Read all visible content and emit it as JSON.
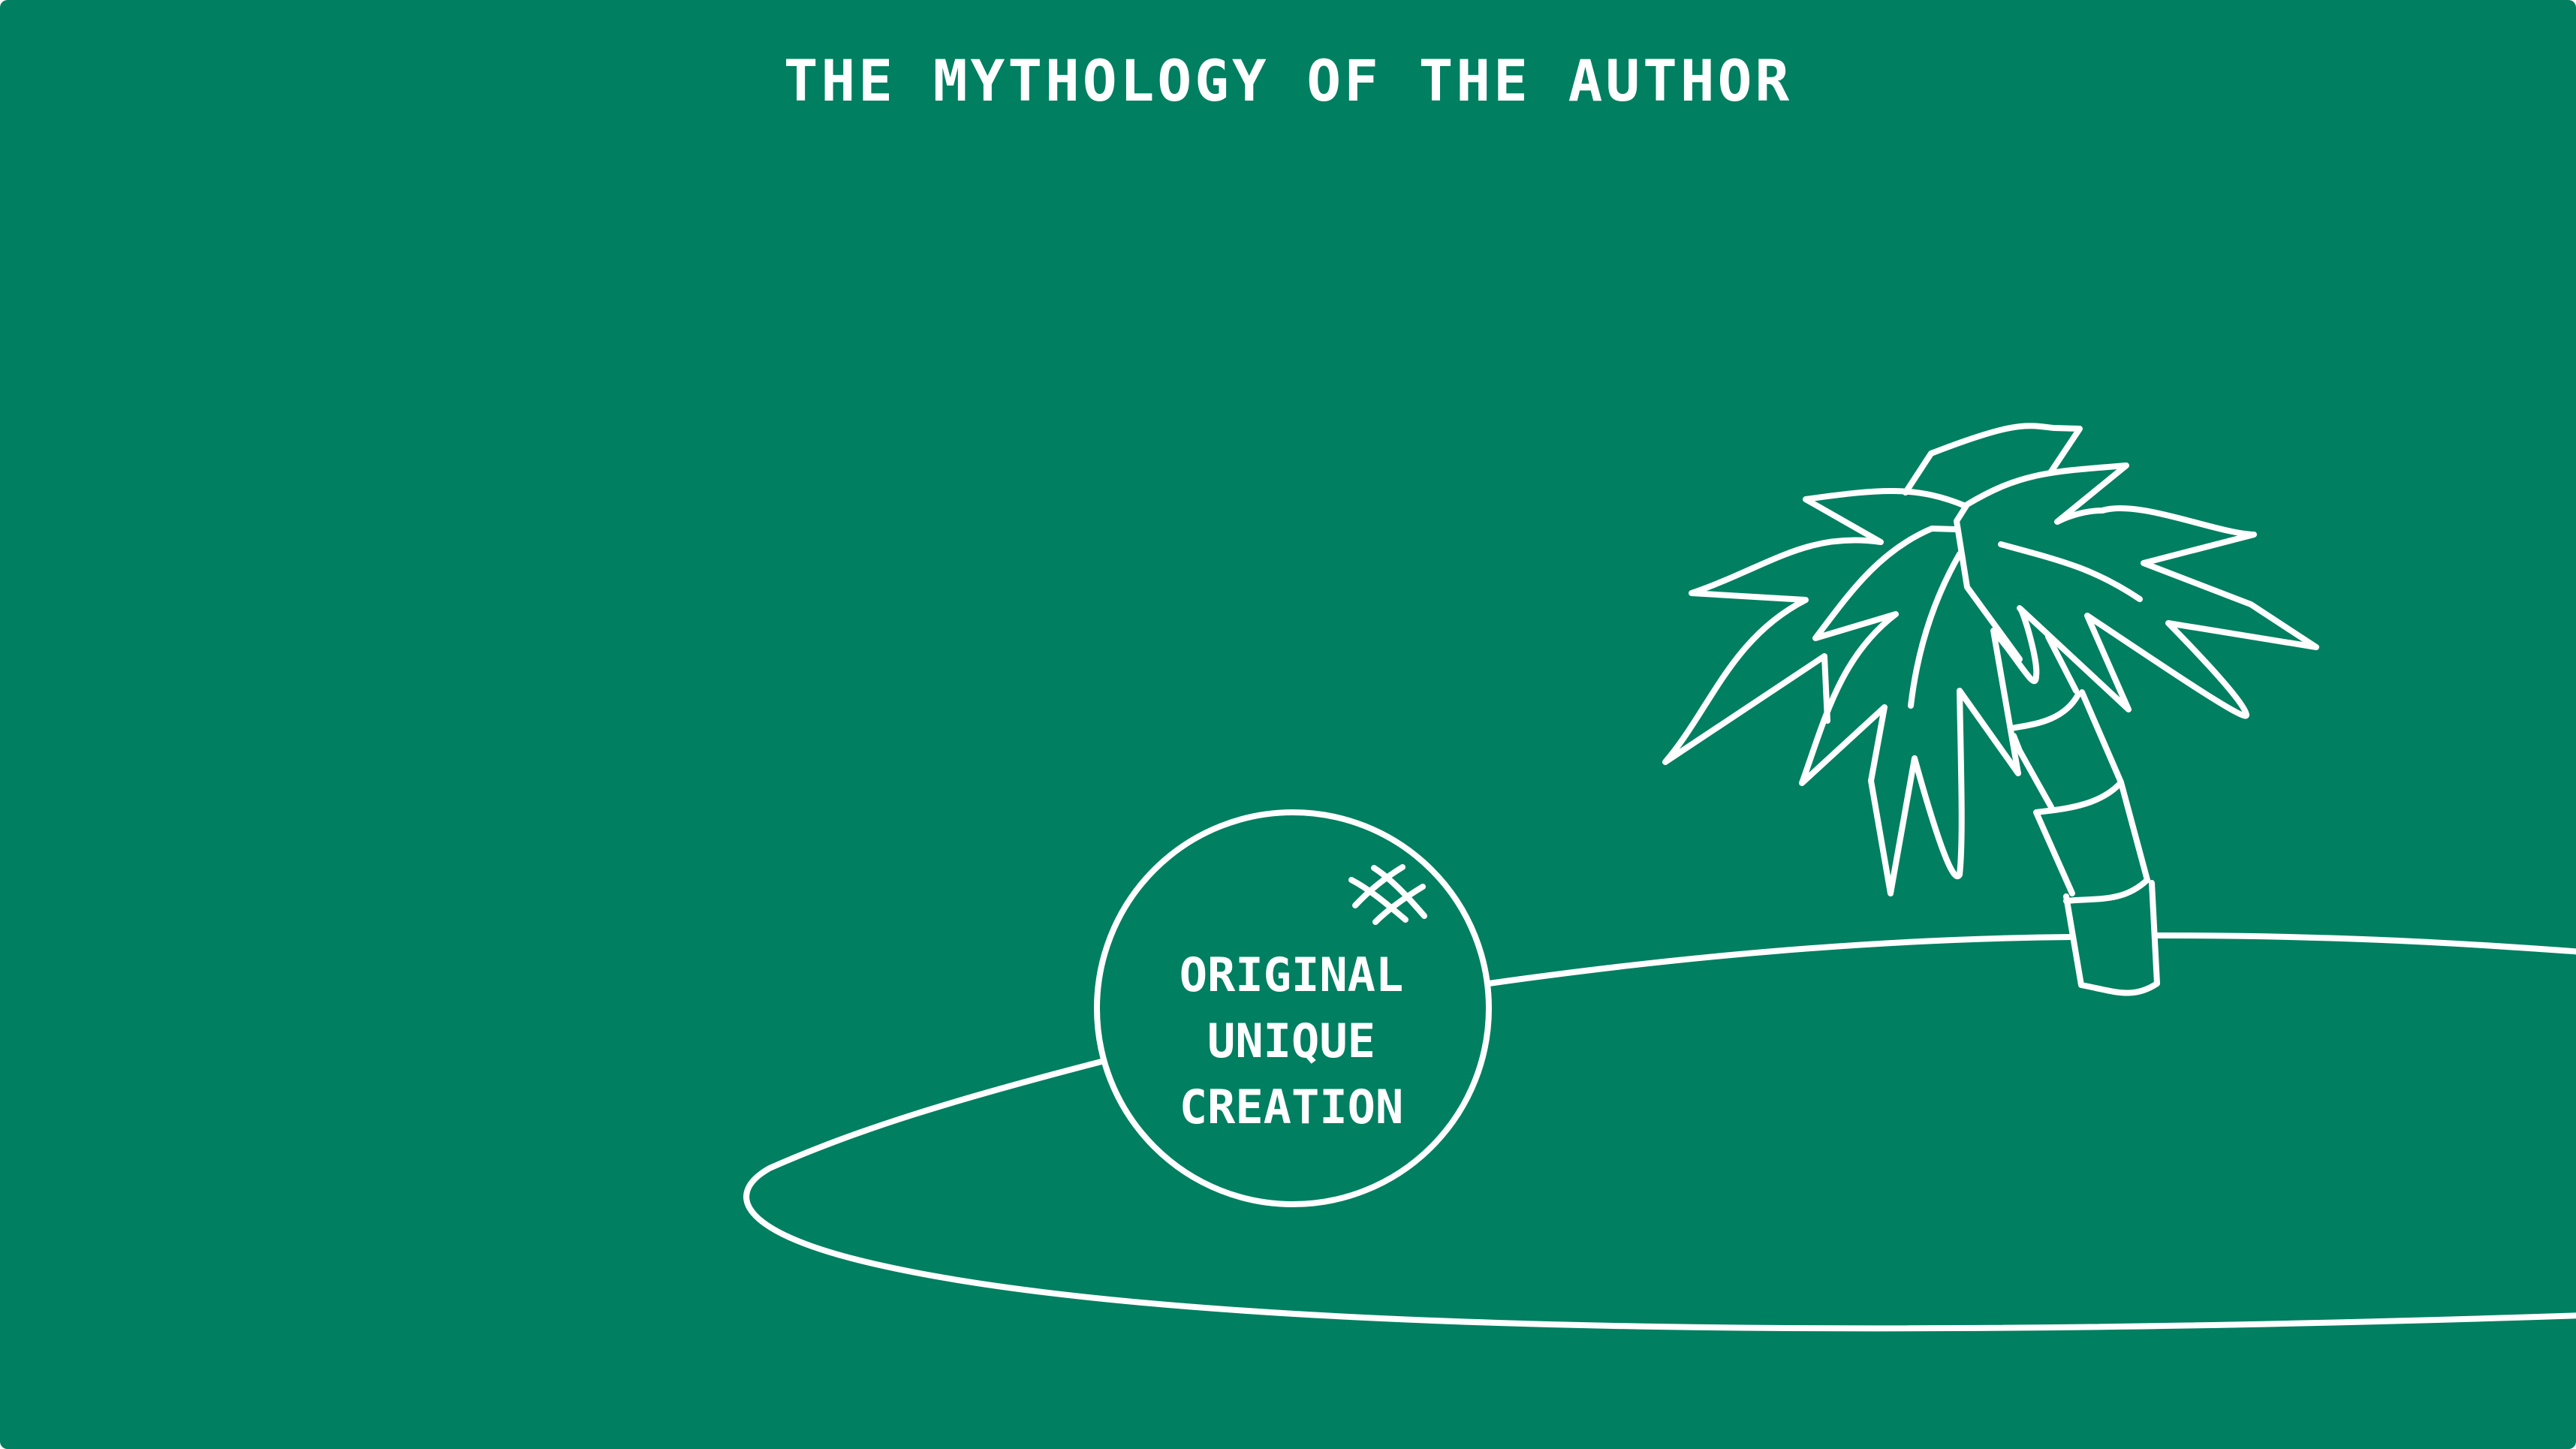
{
  "title": "THE MYTHOLOGY OF THE AUTHOR",
  "node": {
    "lines": [
      "ORIGINAL",
      "UNIQUE",
      "CREATION"
    ]
  },
  "colors": {
    "background": "#007f61",
    "stroke": "#ffffff"
  },
  "icons": [
    "island-outline",
    "palm-tree-icon",
    "sparkle-icon"
  ]
}
